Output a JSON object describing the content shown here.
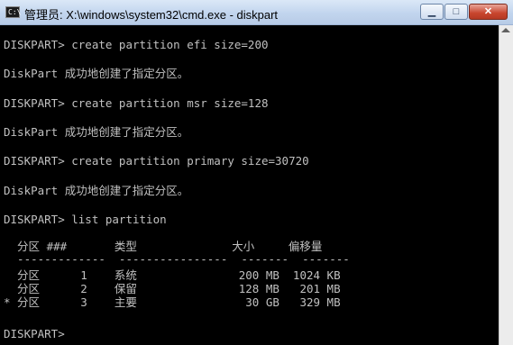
{
  "window": {
    "title": "管理员: X:\\windows\\system32\\cmd.exe - diskpart",
    "icon_text": "C:\\",
    "icon": "cmd-icon"
  },
  "controls": {
    "minimize_glyph": "▁",
    "maximize_glyph": "□",
    "close_glyph": "✕"
  },
  "console": {
    "lines": [
      "DISKPART> create partition efi size=200",
      "DiskPart 成功地创建了指定分区。",
      "DISKPART> create partition msr size=128",
      "DiskPart 成功地创建了指定分区。",
      "DISKPART> create partition primary size=30720",
      "DiskPart 成功地创建了指定分区。",
      "DISKPART> list partition",
      "  分区 ###       类型              大小     偏移量",
      "  -------------  ----------------  -------  -------",
      "  分区      1    系统               200 MB  1024 KB",
      "  分区      2    保留               128 MB   201 MB",
      "* 分区      3    主要                30 GB   329 MB",
      "DISKPART>"
    ]
  }
}
